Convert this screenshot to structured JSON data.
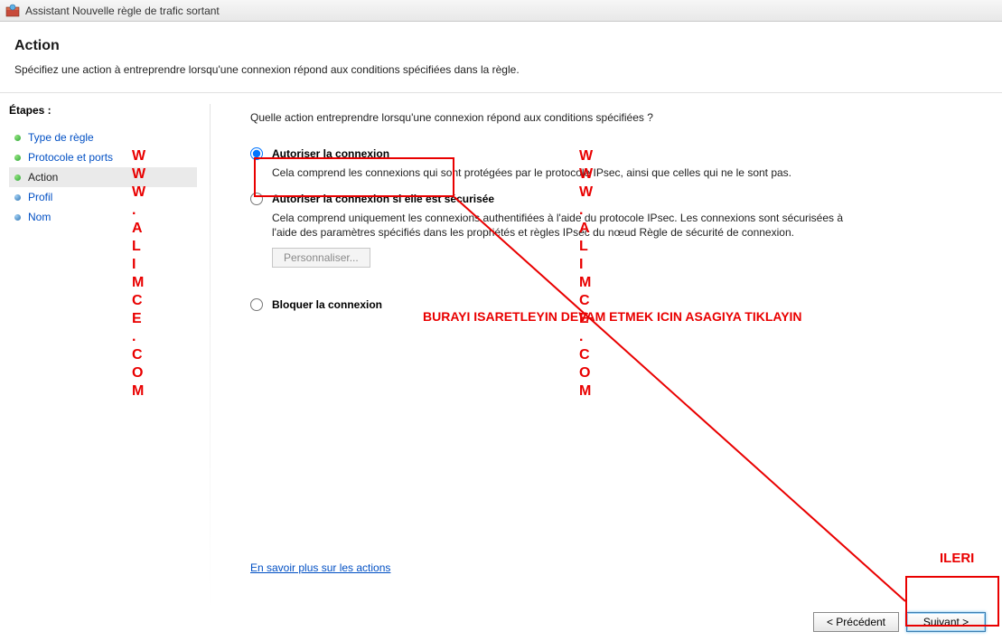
{
  "titlebar": {
    "title": "Assistant Nouvelle règle de trafic sortant"
  },
  "header": {
    "title": "Action",
    "subtitle": "Spécifiez une action à entreprendre lorsqu'une connexion répond aux conditions spécifiées dans la règle."
  },
  "sidebar": {
    "header": "Étapes :",
    "steps": [
      {
        "label": "Type de règle",
        "state": "done"
      },
      {
        "label": "Protocole et ports",
        "state": "done"
      },
      {
        "label": "Action",
        "state": "current"
      },
      {
        "label": "Profil",
        "state": "upcoming"
      },
      {
        "label": "Nom",
        "state": "upcoming"
      }
    ]
  },
  "main": {
    "question": "Quelle action entreprendre lorsqu'une connexion répond aux conditions spécifiées ?",
    "options": [
      {
        "label": "Autoriser la connexion",
        "selected": true,
        "description": "Cela comprend les connexions qui sont protégées par le protocole IPsec, ainsi que celles qui ne le sont pas."
      },
      {
        "label": "Autoriser la connexion si elle est sécurisée",
        "selected": false,
        "description": "Cela comprend uniquement les connexions authentifiées à l'aide du protocole IPsec. Les connexions sont sécurisées à l'aide des paramètres spécifiés dans les propriétés et règles IPsec du nœud Règle de sécurité de connexion.",
        "customize_label": "Personnaliser..."
      },
      {
        "label": "Bloquer la connexion",
        "selected": false
      }
    ],
    "learn_more": "En savoir plus sur les actions"
  },
  "buttons": {
    "back": "< Précédent",
    "next": "Suivant >"
  },
  "annotations": {
    "watermark_left": "W\nW\nW\n.\nA\nL\nI\nM\nC\nE\n.\nC\nO\nM",
    "watermark_center": "W\nW\nW\n.\nA\nL\nI\nM\nC\nE\n.\nC\nO\nM",
    "instruction": "BURAYI ISARETLEYIN DEVAM ETMEK ICIN ASAGIYA TIKLAYIN",
    "next_label": "ILERI"
  }
}
